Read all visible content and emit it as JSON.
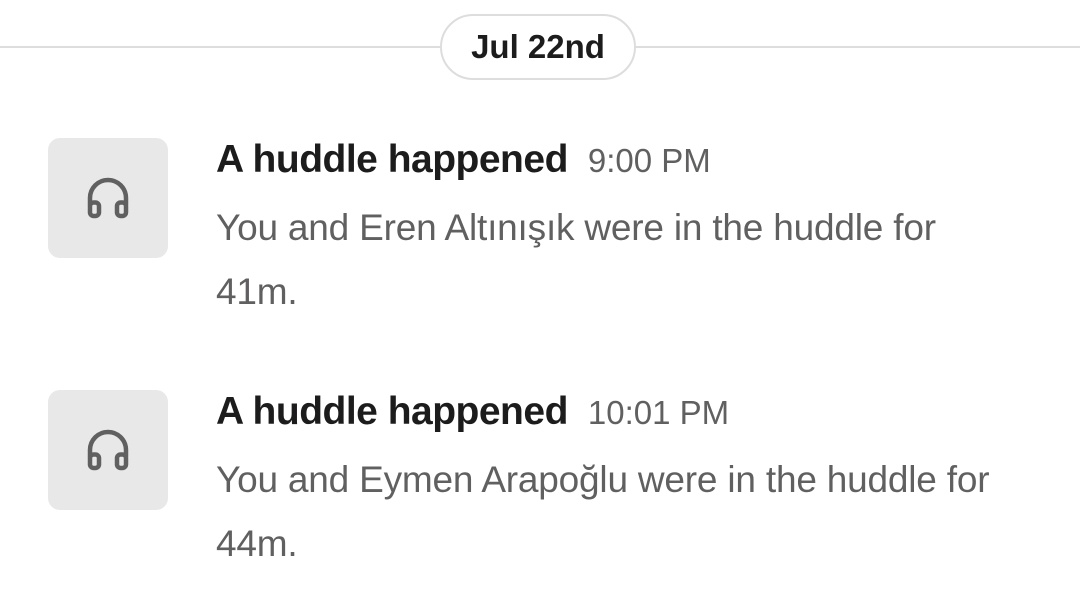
{
  "date_divider": {
    "label": "Jul 22nd"
  },
  "messages": [
    {
      "icon": "headphones-icon",
      "title": "A huddle happened",
      "time": "9:00 PM",
      "body": "You and Eren Altınışık were in the huddle for 41m."
    },
    {
      "icon": "headphones-icon",
      "title": "A huddle happened",
      "time": "10:01 PM",
      "body": "You and Eymen Arapoğlu were in the huddle for 44m."
    }
  ],
  "colors": {
    "avatar_bg": "#e8e8e8",
    "divider": "#dddddd",
    "title_text": "#1d1c1d",
    "secondary_text": "#616061"
  }
}
